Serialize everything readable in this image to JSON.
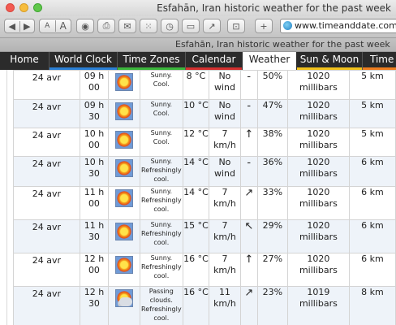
{
  "window": {
    "title": "Esfahān, Iran historic weather for the past week"
  },
  "toolbar": {
    "back_icon": "back-arrow-icon",
    "forward_icon": "forward-arrow-icon",
    "text_smaller": "A",
    "text_bigger": "A",
    "address": "www.timeanddate.com/w"
  },
  "tab": {
    "title": "Esfahān, Iran historic weather for the past week"
  },
  "nav": {
    "items": [
      {
        "label": "Home",
        "color": "#2b2b2b"
      },
      {
        "label": "World Clock",
        "color": "#2a7fd4"
      },
      {
        "label": "Time Zones",
        "color": "#3bb53b"
      },
      {
        "label": "Calendar",
        "color": "#d3302f"
      },
      {
        "label": "Weather",
        "color": "#ffffff",
        "active": true
      },
      {
        "label": "Sun & Moon",
        "color": "#f2c21b"
      },
      {
        "label": "Time",
        "color": "#ee7d1e"
      }
    ]
  },
  "table": {
    "rows": [
      {
        "date": "24 avr",
        "time": [
          "09 h",
          "00"
        ],
        "icon": "sunny",
        "desc": [
          "Sunny.",
          "Cool."
        ],
        "temp": "8 °C",
        "wind": [
          "No",
          "wind"
        ],
        "dir": "-",
        "hum": "50%",
        "pressure": [
          "1020",
          "millibars"
        ],
        "vis": "5 km"
      },
      {
        "date": "24 avr",
        "time": [
          "09 h",
          "30"
        ],
        "icon": "sunny",
        "desc": [
          "Sunny.",
          "Cool."
        ],
        "temp": "10 °C",
        "wind": [
          "No",
          "wind"
        ],
        "dir": "-",
        "hum": "47%",
        "pressure": [
          "1020",
          "millibars"
        ],
        "vis": "5 km"
      },
      {
        "date": "24 avr",
        "time": [
          "10 h",
          "00"
        ],
        "icon": "sunny",
        "desc": [
          "Sunny.",
          "Cool."
        ],
        "temp": "12 °C",
        "wind": [
          "7 km/h"
        ],
        "dir": "↑",
        "hum": "38%",
        "pressure": [
          "1020",
          "millibars"
        ],
        "vis": "5 km"
      },
      {
        "date": "24 avr",
        "time": [
          "10 h",
          "30"
        ],
        "icon": "sunny",
        "desc": [
          "Sunny.",
          "Refreshingly",
          "cool."
        ],
        "temp": "14 °C",
        "wind": [
          "No",
          "wind"
        ],
        "dir": "-",
        "hum": "36%",
        "pressure": [
          "1020",
          "millibars"
        ],
        "vis": "6 km"
      },
      {
        "date": "24 avr",
        "time": [
          "11 h",
          "00"
        ],
        "icon": "sunny",
        "desc": [
          "Sunny.",
          "Refreshingly",
          "cool."
        ],
        "temp": "14 °C",
        "wind": [
          "7 km/h"
        ],
        "dir": "↗",
        "hum": "33%",
        "pressure": [
          "1020",
          "millibars"
        ],
        "vis": "6 km"
      },
      {
        "date": "24 avr",
        "time": [
          "11 h",
          "30"
        ],
        "icon": "sunny",
        "desc": [
          "Sunny.",
          "Refreshingly",
          "cool."
        ],
        "temp": "15 °C",
        "wind": [
          "7 km/h"
        ],
        "dir": "↖",
        "hum": "29%",
        "pressure": [
          "1020",
          "millibars"
        ],
        "vis": "6 km"
      },
      {
        "date": "24 avr",
        "time": [
          "12 h",
          "00"
        ],
        "icon": "sunny",
        "desc": [
          "Sunny.",
          "Refreshingly",
          "cool."
        ],
        "temp": "16 °C",
        "wind": [
          "7 km/h"
        ],
        "dir": "↑",
        "hum": "27%",
        "pressure": [
          "1020",
          "millibars"
        ],
        "vis": "6 km"
      },
      {
        "date": "24 avr",
        "time": [
          "12 h",
          "30"
        ],
        "icon": "passing-clouds",
        "desc": [
          "Passing",
          "clouds.",
          "Refreshingly",
          "cool."
        ],
        "temp": "16 °C",
        "wind": [
          "11",
          "km/h"
        ],
        "dir": "↗",
        "hum": "23%",
        "pressure": [
          "1019",
          "millibars"
        ],
        "vis": "8 km"
      }
    ]
  }
}
